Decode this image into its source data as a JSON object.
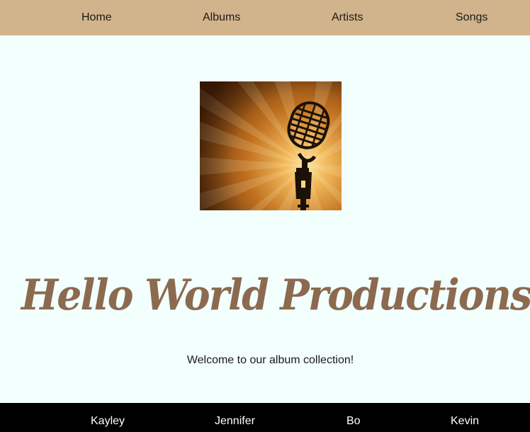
{
  "nav": {
    "items": [
      {
        "label": "Home"
      },
      {
        "label": "Albums"
      },
      {
        "label": "Artists"
      },
      {
        "label": "Songs"
      }
    ]
  },
  "hero": {
    "icon": "microphone-icon",
    "colors": {
      "dark": "#5a2b06",
      "mid": "#b0611c",
      "light": "#f6d87c"
    }
  },
  "title": "Hello World Productions",
  "welcome": "Welcome to our album collection!",
  "footer": {
    "names": [
      "Kayley",
      "Jennifer",
      "Bo",
      "Kevin"
    ]
  },
  "colors": {
    "nav_bg": "#d2b48c",
    "page_bg": "#f3fffd",
    "title": "#8b6a50",
    "footer_bg": "#000000"
  }
}
